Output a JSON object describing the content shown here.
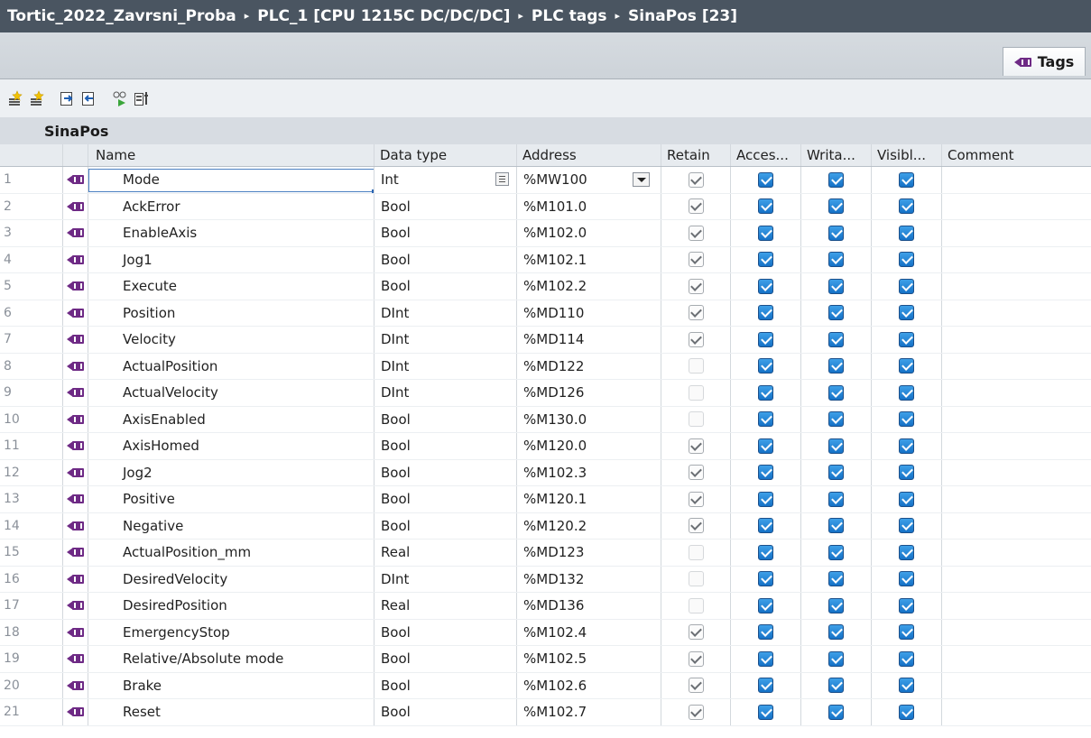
{
  "breadcrumb": {
    "project": "Tortic_2022_Zavrsni_Proba",
    "device": "PLC_1 [CPU 1215C DC/DC/DC]",
    "folder": "PLC tags",
    "table": "SinaPos [23]",
    "separator": "▸"
  },
  "tab": {
    "label": "Tags",
    "icon": "tag-icon"
  },
  "toolbar": {
    "icons": [
      "add-row-icon",
      "insert-row-icon",
      "export-icon",
      "import-icon",
      "monitor-icon",
      "show-all-icon"
    ]
  },
  "table_title": "SinaPos",
  "columns": {
    "name": "Name",
    "data_type": "Data type",
    "address": "Address",
    "retain": "Retain",
    "accessible": "Acces...",
    "writable": "Writa...",
    "visible": "Visibl...",
    "comment": "Comment"
  },
  "rows": [
    {
      "num": "1",
      "name": "Mode",
      "type": "Int",
      "address": "%MW100",
      "retain": true,
      "accessible": true,
      "writable": true,
      "visible": true,
      "comment": ""
    },
    {
      "num": "2",
      "name": "AckError",
      "type": "Bool",
      "address": "%M101.0",
      "retain": true,
      "accessible": true,
      "writable": true,
      "visible": true,
      "comment": ""
    },
    {
      "num": "3",
      "name": "EnableAxis",
      "type": "Bool",
      "address": "%M102.0",
      "retain": true,
      "accessible": true,
      "writable": true,
      "visible": true,
      "comment": ""
    },
    {
      "num": "4",
      "name": "Jog1",
      "type": "Bool",
      "address": "%M102.1",
      "retain": true,
      "accessible": true,
      "writable": true,
      "visible": true,
      "comment": ""
    },
    {
      "num": "5",
      "name": "Execute",
      "type": "Bool",
      "address": "%M102.2",
      "retain": true,
      "accessible": true,
      "writable": true,
      "visible": true,
      "comment": ""
    },
    {
      "num": "6",
      "name": "Position",
      "type": "DInt",
      "address": "%MD110",
      "retain": true,
      "accessible": true,
      "writable": true,
      "visible": true,
      "comment": ""
    },
    {
      "num": "7",
      "name": "Velocity",
      "type": "DInt",
      "address": "%MD114",
      "retain": true,
      "accessible": true,
      "writable": true,
      "visible": true,
      "comment": ""
    },
    {
      "num": "8",
      "name": "ActualPosition",
      "type": "DInt",
      "address": "%MD122",
      "retain": false,
      "accessible": true,
      "writable": true,
      "visible": true,
      "comment": ""
    },
    {
      "num": "9",
      "name": "ActualVelocity",
      "type": "DInt",
      "address": "%MD126",
      "retain": false,
      "accessible": true,
      "writable": true,
      "visible": true,
      "comment": ""
    },
    {
      "num": "10",
      "name": "AxisEnabled",
      "type": "Bool",
      "address": "%M130.0",
      "retain": false,
      "accessible": true,
      "writable": true,
      "visible": true,
      "comment": ""
    },
    {
      "num": "11",
      "name": "AxisHomed",
      "type": "Bool",
      "address": "%M120.0",
      "retain": true,
      "accessible": true,
      "writable": true,
      "visible": true,
      "comment": ""
    },
    {
      "num": "12",
      "name": "Jog2",
      "type": "Bool",
      "address": "%M102.3",
      "retain": true,
      "accessible": true,
      "writable": true,
      "visible": true,
      "comment": ""
    },
    {
      "num": "13",
      "name": "Positive",
      "type": "Bool",
      "address": "%M120.1",
      "retain": true,
      "accessible": true,
      "writable": true,
      "visible": true,
      "comment": ""
    },
    {
      "num": "14",
      "name": "Negative",
      "type": "Bool",
      "address": "%M120.2",
      "retain": true,
      "accessible": true,
      "writable": true,
      "visible": true,
      "comment": ""
    },
    {
      "num": "15",
      "name": "ActualPosition_mm",
      "type": "Real",
      "address": "%MD123",
      "retain": false,
      "accessible": true,
      "writable": true,
      "visible": true,
      "comment": ""
    },
    {
      "num": "16",
      "name": "DesiredVelocity",
      "type": "DInt",
      "address": "%MD132",
      "retain": false,
      "accessible": true,
      "writable": true,
      "visible": true,
      "comment": ""
    },
    {
      "num": "17",
      "name": "DesiredPosition",
      "type": "Real",
      "address": "%MD136",
      "retain": false,
      "accessible": true,
      "writable": true,
      "visible": true,
      "comment": ""
    },
    {
      "num": "18",
      "name": "EmergencyStop",
      "type": "Bool",
      "address": "%M102.4",
      "retain": true,
      "accessible": true,
      "writable": true,
      "visible": true,
      "comment": ""
    },
    {
      "num": "19",
      "name": "Relative/Absolute mode",
      "type": "Bool",
      "address": "%M102.5",
      "retain": true,
      "accessible": true,
      "writable": true,
      "visible": true,
      "comment": ""
    },
    {
      "num": "20",
      "name": "Brake",
      "type": "Bool",
      "address": "%M102.6",
      "retain": true,
      "accessible": true,
      "writable": true,
      "visible": true,
      "comment": ""
    },
    {
      "num": "21",
      "name": "Reset",
      "type": "Bool",
      "address": "%M102.7",
      "retain": true,
      "accessible": true,
      "writable": true,
      "visible": true,
      "comment": ""
    }
  ],
  "selected_row": 0,
  "colors": {
    "titlebar": "#4a5561",
    "tag_icon": "#6e2a85",
    "checkbox_blue": "#1571c6"
  }
}
